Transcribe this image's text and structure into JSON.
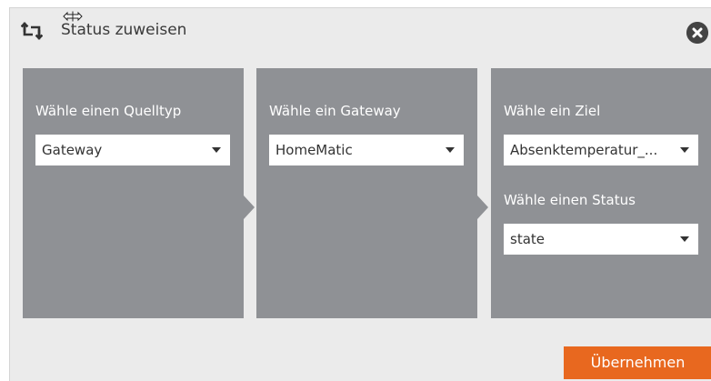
{
  "dialog": {
    "title": "Status zuweisen",
    "title_icon": "repeat-icon",
    "close_icon": "close-icon"
  },
  "columns": [
    {
      "label": "Wähle einen Quelltyp",
      "select_value": "Gateway"
    },
    {
      "label": "Wähle ein Gateway",
      "select_value": "HomeMatic"
    },
    {
      "label": "Wähle ein Ziel",
      "select_value": "Absenktemperatur_...",
      "status_label": "Wähle einen Status",
      "status_value": "state"
    }
  ],
  "footer": {
    "apply_label": "Übernehmen"
  },
  "colors": {
    "dialog_bg": "#ebebeb",
    "panel_bg": "#8f9195",
    "accent": "#e8681f"
  }
}
